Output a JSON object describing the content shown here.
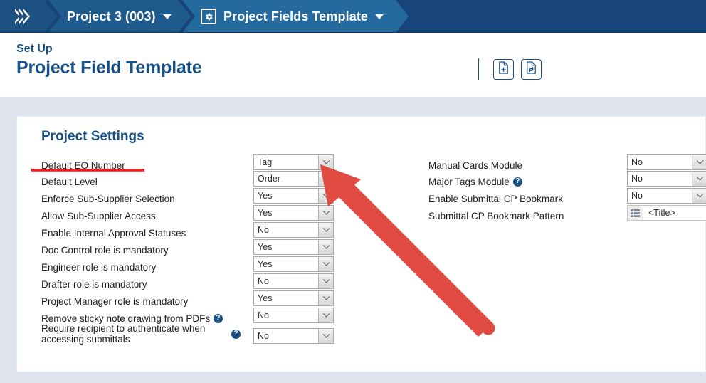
{
  "breadcrumb": {
    "logo_icon": "chevrons-right-icon",
    "items": [
      {
        "label": "Project 3 (003)",
        "icon": "",
        "caret": "chevron-down-icon"
      },
      {
        "label": "Project Fields Template",
        "icon": "gear-icon",
        "caret": "chevron-down-icon"
      }
    ]
  },
  "header": {
    "eyebrow": "Set Up",
    "title": "Project Field Template",
    "actions": [
      {
        "name": "new-document-button",
        "icon": "document-plus-icon"
      },
      {
        "name": "refresh-document-button",
        "icon": "document-refresh-icon"
      }
    ]
  },
  "card": {
    "section_title": "Project Settings",
    "left_fields": [
      {
        "label": "Default EQ Number",
        "value": "Tag",
        "help": false,
        "control": "select"
      },
      {
        "label": "Default Level",
        "value": "Order",
        "help": false,
        "control": "select"
      },
      {
        "label": "Enforce Sub-Supplier Selection",
        "value": "Yes",
        "help": false,
        "control": "select"
      },
      {
        "label": "Allow Sub-Supplier Access",
        "value": "Yes",
        "help": false,
        "control": "select"
      },
      {
        "label": "Enable Internal Approval Statuses",
        "value": "No",
        "help": false,
        "control": "select"
      },
      {
        "label": "Doc Control role is mandatory",
        "value": "Yes",
        "help": false,
        "control": "select"
      },
      {
        "label": "Engineer role is mandatory",
        "value": "Yes",
        "help": false,
        "control": "select"
      },
      {
        "label": "Drafter role is mandatory",
        "value": "No",
        "help": false,
        "control": "select"
      },
      {
        "label": "Project Manager role is mandatory",
        "value": "Yes",
        "help": false,
        "control": "select"
      },
      {
        "label": "Remove sticky note drawing from PDFs",
        "value": "No",
        "help": true,
        "control": "select"
      },
      {
        "label": "Require recipient to authenticate when accessing submittals",
        "value": "No",
        "help": true,
        "control": "select"
      }
    ],
    "right_fields": [
      {
        "label": "Manual Cards Module",
        "value": "No",
        "help": false,
        "control": "select"
      },
      {
        "label": "Major Tags Module",
        "value": "No",
        "help": true,
        "control": "select"
      },
      {
        "label": "Enable Submittal CP Bookmark",
        "value": "No",
        "help": false,
        "control": "select"
      },
      {
        "label": "Submittal CP Bookmark Pattern",
        "value": "<Title>",
        "help": false,
        "control": "pattern"
      }
    ]
  },
  "annotations": {
    "arrow": {
      "name": "red-arrow-annotation",
      "color": "#e04b42"
    },
    "underline": {
      "name": "red-underline-annotation",
      "color": "#f21b1b",
      "target": "Default EQ Number"
    }
  },
  "colors": {
    "brand_dark": "#17447a",
    "brand_mid": "#246a9e",
    "heading": "#174f87",
    "page_bg": "#dfe4ef",
    "annotation_red": "#e04b42"
  }
}
